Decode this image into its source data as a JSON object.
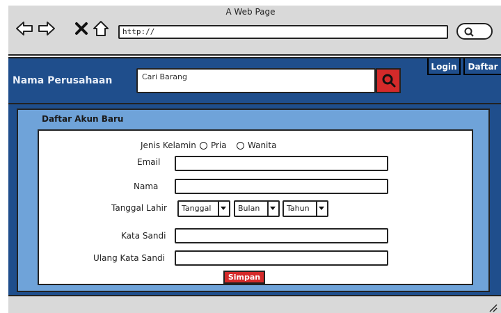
{
  "browser": {
    "window_title": "A Web Page",
    "url": "http://",
    "icons": [
      "back-arrow-icon",
      "forward-arrow-icon",
      "close-icon",
      "home-icon",
      "search-icon"
    ]
  },
  "header": {
    "company_name": "Nama Perusahaan",
    "search_placeholder": "Cari Barang",
    "login_label": "Login",
    "signup_label": "Daftar",
    "accent_color": "#1f4e8c",
    "search_button_color": "#d42a2a"
  },
  "panel": {
    "title": "Daftar Akun Baru"
  },
  "form": {
    "gender_label": "Jenis Kelamin",
    "gender_options": [
      "Pria",
      "Wanita"
    ],
    "email_label": "Email",
    "name_label": "Nama",
    "birthdate_label": "Tanggal Lahir",
    "day_select": "Tanggal",
    "month_select": "Bulan",
    "year_select": "Tahun",
    "password_label": "Kata Sandi",
    "confirm_password_label": "Ulang Kata Sandi",
    "save_label": "Simpan"
  }
}
